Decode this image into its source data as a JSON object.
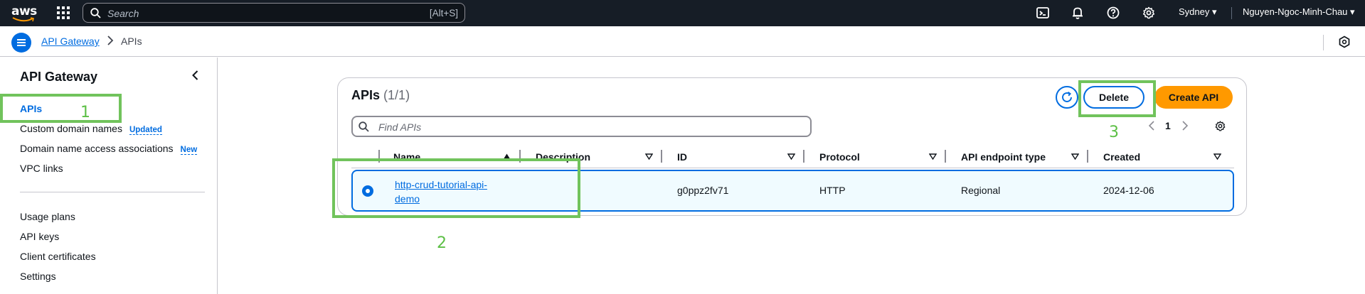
{
  "topbar": {
    "logo_text": "aws",
    "search_placeholder": "Search",
    "search_shortcut": "[Alt+S]",
    "region": "Sydney ▾",
    "user": "Nguyen-Ngoc-Minh-Chau ▾",
    "icons": [
      "cloudshell-icon",
      "bell-icon",
      "help-icon",
      "gear-icon"
    ]
  },
  "breadcrumb": {
    "root": "API Gateway",
    "current": "APIs"
  },
  "sidebar": {
    "title": "API Gateway",
    "items": [
      {
        "label": "APIs",
        "active": true
      },
      {
        "label": "Custom domain names",
        "badge": "Updated"
      },
      {
        "label": "Domain name access associations",
        "badge": "New"
      },
      {
        "label": "VPC links"
      },
      {
        "label": "Usage plans"
      },
      {
        "label": "API keys"
      },
      {
        "label": "Client certificates"
      },
      {
        "label": "Settings"
      }
    ]
  },
  "panel": {
    "title": "APIs",
    "count": "(1/1)",
    "delete_label": "Delete",
    "create_label": "Create API",
    "find_placeholder": "Find APIs",
    "page": "1",
    "columns": [
      "Name",
      "Description",
      "ID",
      "Protocol",
      "API endpoint type",
      "Created"
    ],
    "rows": [
      {
        "name": "http-crud-tutorial-api-demo",
        "description": "",
        "id": "g0ppz2fv71",
        "protocol": "HTTP",
        "endpoint_type": "Regional",
        "created": "2024-12-06",
        "selected": true
      }
    ]
  },
  "annotations": {
    "step1": "1",
    "step2": "2",
    "step3": "3"
  },
  "colors": {
    "topbar_bg": "#161d26",
    "link_blue": "#006ce0",
    "primary_orange": "#ff9900",
    "annotation_green": "#71c35c",
    "selected_row_bg": "#f0fbff"
  }
}
